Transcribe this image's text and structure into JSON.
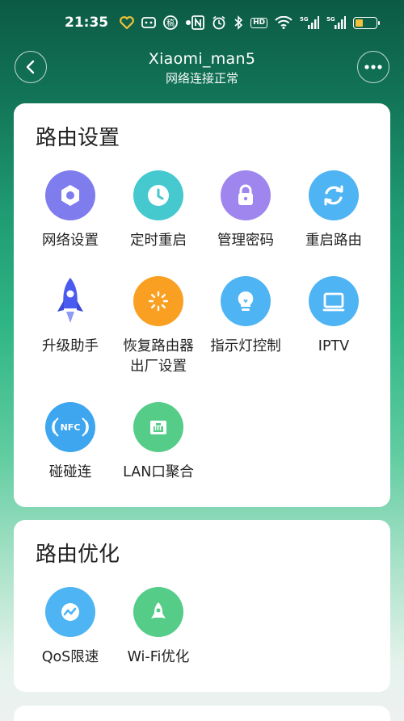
{
  "status_bar": {
    "time": "21:35",
    "hd_badge": "HD",
    "net1": "5G",
    "net2": "5G",
    "battery_level": 0.35,
    "left_icons": [
      "heart-icon",
      "message-icon",
      "app-icon",
      "dot-icon"
    ],
    "right_icons": [
      "nfc-icon",
      "alarm-icon",
      "bluetooth-icon",
      "hd-icon",
      "wifi-icon",
      "signal-icon",
      "signal-icon",
      "battery-icon"
    ]
  },
  "header": {
    "title": "Xiaomi_man5",
    "subtitle": "网络连接正常",
    "back_icon": "chevron-left-icon",
    "more_icon": "more-dots-icon"
  },
  "router_settings": {
    "title": "路由设置",
    "items": [
      {
        "label": "网络设置",
        "icon": "gear-hex-icon",
        "color": "#7f7ded"
      },
      {
        "label": "定时重启",
        "icon": "clock-icon",
        "color": "#45c9cf"
      },
      {
        "label": "管理密码",
        "icon": "lock-icon",
        "color": "#9f86ee"
      },
      {
        "label": "重启路由",
        "icon": "refresh-icon",
        "color": "#4eb4f3"
      },
      {
        "label": "升级助手",
        "icon": "rocket-icon",
        "color": "#4a5bf0"
      },
      {
        "label": "恢复路由器",
        "label2": "出厂设置",
        "icon": "reset-sun-icon",
        "color": "#f9a023"
      },
      {
        "label": "指示灯控制",
        "icon": "bulb-icon",
        "color": "#4eb4f3"
      },
      {
        "label": "IPTV",
        "icon": "tv-icon",
        "color": "#4eb4f3"
      },
      {
        "label": "碰碰连",
        "icon": "nfc-icon",
        "color": "#3ea6ef"
      },
      {
        "label": "LAN口聚合",
        "icon": "lan-port-icon",
        "color": "#55cc88"
      }
    ]
  },
  "router_optimize": {
    "title": "路由优化",
    "items": [
      {
        "label": "QoS限速",
        "icon": "qos-wave-icon",
        "color": "#4eb4f3"
      },
      {
        "label": "Wi-Fi优化",
        "icon": "rocket-wifi-icon",
        "color": "#55cc88"
      }
    ]
  }
}
